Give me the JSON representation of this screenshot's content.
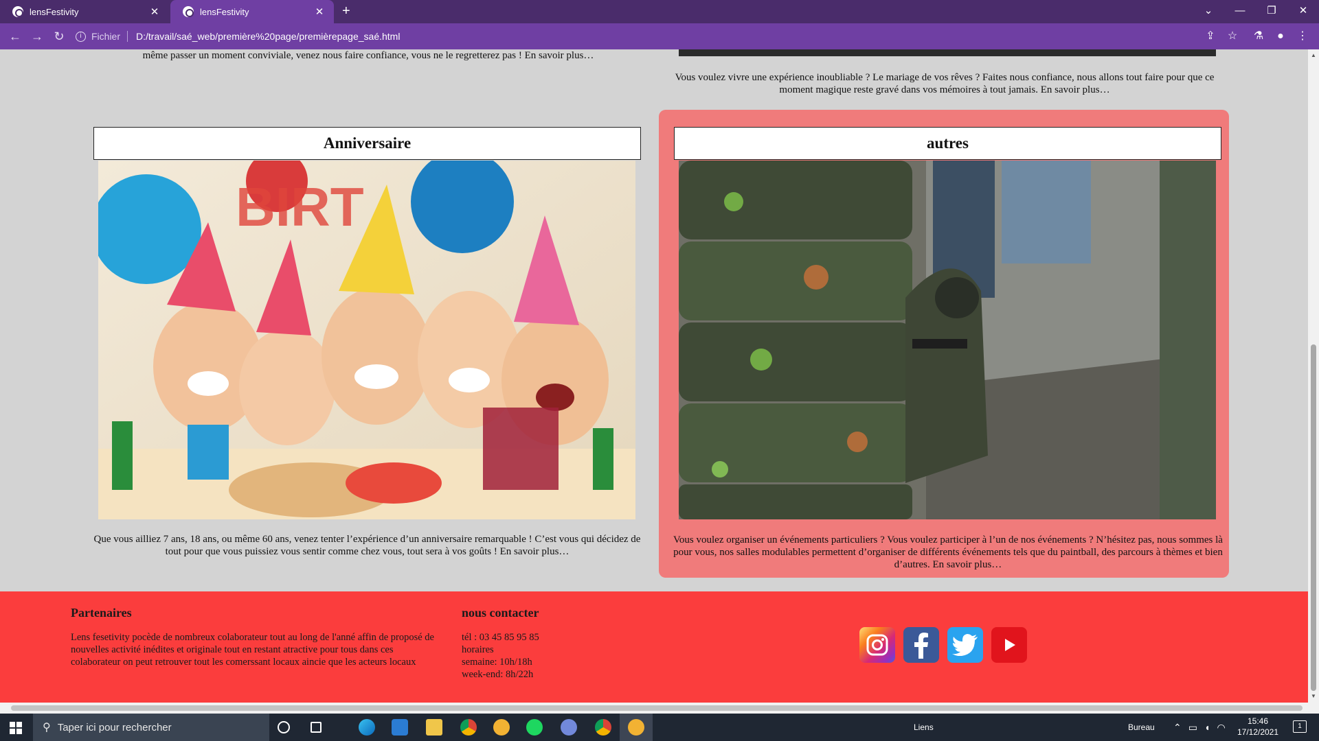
{
  "browser": {
    "tabs": [
      {
        "label": "lensFestivity",
        "active": false
      },
      {
        "label": "lensFestivity",
        "active": true
      }
    ],
    "address": {
      "scheme": "Fichier",
      "url": "D:/travail/saé_web/première%20page/premièrepage_saé.html"
    }
  },
  "page": {
    "top_left_text": "même passer un moment conviviale, venez nous faire confiance, vous ne le regretterez pas ! En savoir plus…",
    "top_right_text": "Vous voulez vivre une expérience inoubliable ? Le mariage de vos rêves ? Faites nous confiance, nous allons tout faire pour que ce moment magique reste gravé dans vos mémoires à tout jamais. En savoir plus…",
    "cards": [
      {
        "title": "Anniversaire",
        "image": "birthday-party-children-photo",
        "text": "Que vous ailliez 7 ans, 18 ans, ou même 60 ans, venez tenter l’expérience d’un anniversaire remarquable ! C’est vous qui décidez de tout pour que vous puissiez vous sentir comme chez vous, tout sera à vos goûts ! En savoir plus…"
      },
      {
        "title": "autres",
        "image": "paintball-tires-photo",
        "text": "Vous voulez organiser un événements particuliers ? Vous voulez participer à l’un de nos événements ? N’hésitez pas, nous sommes là pour vous, nos salles modulables permettent d’organiser de différents événements tels que du paintball, des parcours à thèmes et bien d’autres. En savoir plus…"
      }
    ]
  },
  "footer": {
    "partners_title": "Partenaires",
    "partners_text": "Lens fesetivity pocède de nombreux colaborateur tout au long de l'anné affin de proposé de nouvelles activité inédites et originale tout en restant atractive pour tous dans ces colaborateur on peut retrouver tout les comerssant locaux aincie que les acteurs locaux",
    "contact_title": "nous contacter",
    "contact_lines": [
      "tél : 03 45 85 95 85",
      "horaires",
      "semaine: 10h/18h",
      "week-end: 8h/22h"
    ],
    "social": [
      "instagram-icon",
      "facebook-icon",
      "twitter-icon",
      "youtube-icon"
    ]
  },
  "taskbar": {
    "search_placeholder": "Taper ici pour rechercher",
    "links_label": "Liens",
    "desktop_label": "Bureau",
    "time": "15:46",
    "date": "17/12/2021",
    "notification_count": "1"
  },
  "colors": {
    "tabbar": "#4a2c6b",
    "toolbar": "#6f3fa3",
    "footer": "#fb3d3d",
    "card_highlight": "#f07b7b"
  }
}
